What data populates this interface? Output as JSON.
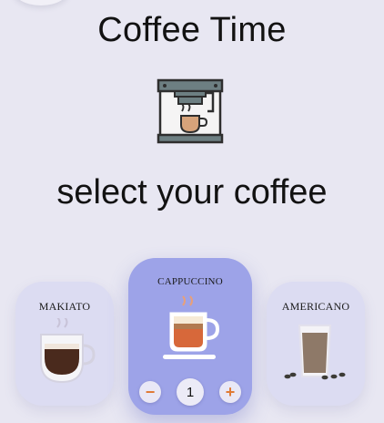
{
  "header": {
    "title": "Coffee Time"
  },
  "subtitle": "select your coffee",
  "coffees": [
    {
      "name": "MAKIATO"
    },
    {
      "name": "CAPPUCCINO",
      "quantity": "1",
      "decrease_label": "−",
      "increase_label": "+"
    },
    {
      "name": "AMERICANO"
    }
  ],
  "colors": {
    "background": "#e8e7f2",
    "card": "#dcdcf2",
    "card_selected": "#9da3e8",
    "accent": "#e07a35"
  },
  "icons": [
    "coffee-machine-icon",
    "makiato-cup-icon",
    "cappuccino-cup-icon",
    "americano-glass-icon",
    "minus-icon",
    "plus-icon"
  ]
}
